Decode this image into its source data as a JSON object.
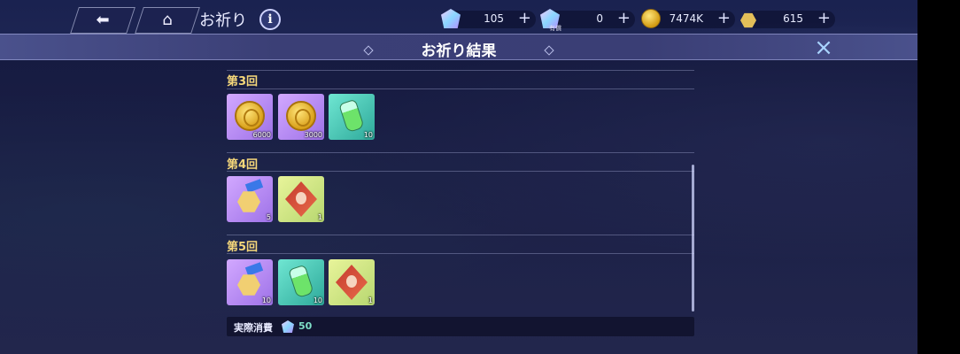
{
  "topbar": {
    "back_icon": "back-arrow-icon",
    "home_icon": "home-icon",
    "title": "お祈り",
    "info_label": "i",
    "resources": [
      {
        "name": "gem",
        "value": "105",
        "plus": "+"
      },
      {
        "name": "gem-2",
        "value": "0",
        "plus": "+",
        "sub_label": "有償"
      },
      {
        "name": "coin",
        "value": "7474K",
        "plus": "+"
      },
      {
        "name": "star-coin",
        "value": "615",
        "plus": "+"
      }
    ]
  },
  "modal": {
    "title": "お祈り結果",
    "close_icon": "×",
    "rounds": [
      {
        "label": "第3回",
        "items": [
          {
            "kind": "coin",
            "bg": "purple",
            "count": "6000"
          },
          {
            "kind": "coin",
            "bg": "purple",
            "count": "3000"
          },
          {
            "kind": "bottle",
            "bg": "teal",
            "count": "10"
          }
        ]
      },
      {
        "label": "第4回",
        "items": [
          {
            "kind": "hexcoin",
            "bg": "purple",
            "count": "5"
          },
          {
            "kind": "portrait",
            "bg": "yellow",
            "count": "1"
          }
        ]
      },
      {
        "label": "第5回",
        "items": [
          {
            "kind": "hexcoin",
            "bg": "purple",
            "count": "10"
          },
          {
            "kind": "bottle",
            "bg": "teal",
            "count": "10"
          },
          {
            "kind": "portrait",
            "bg": "yellow",
            "count": "1"
          }
        ]
      }
    ],
    "footer": {
      "label": "実際消費",
      "amount": "50"
    }
  },
  "colors": {
    "round_label": "#f5d77a",
    "close": "#a9d4ff",
    "amount": "#7fe0c8"
  }
}
